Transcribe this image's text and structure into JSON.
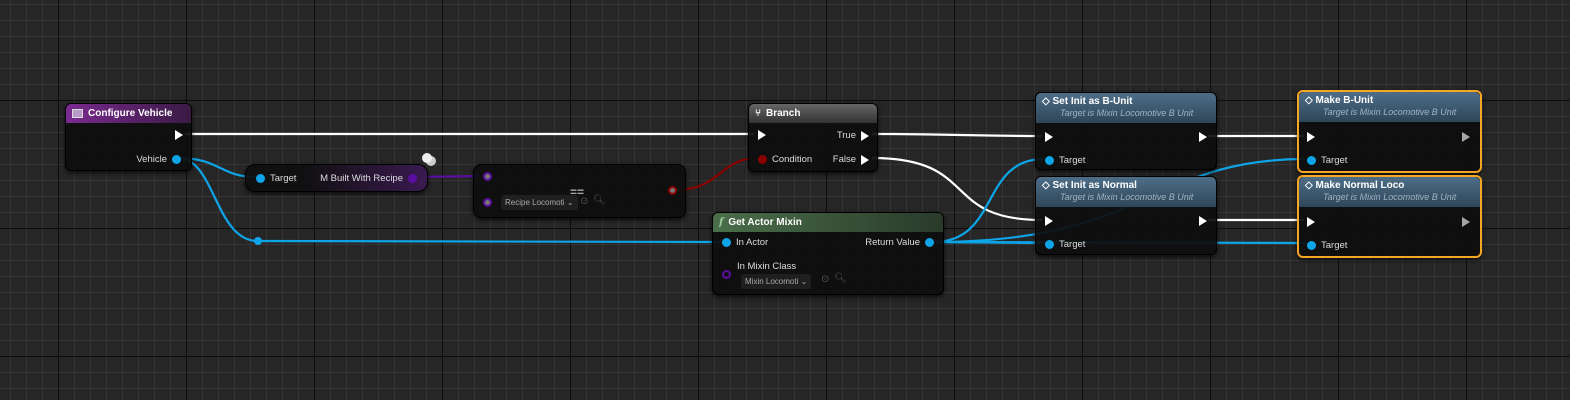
{
  "nodes": {
    "configure_vehicle": {
      "title": "Configure Vehicle",
      "pin_vehicle": "Vehicle"
    },
    "getter": {
      "target": "Target",
      "output": "M Built With Recipe"
    },
    "equal": {
      "operator": "==",
      "dropdown": "Recipe Locomoti"
    },
    "branch": {
      "title": "Branch",
      "condition": "Condition",
      "true": "True",
      "false": "False"
    },
    "get_actor_mixin": {
      "title": "Get Actor Mixin",
      "in_actor": "In Actor",
      "return_value": "Return Value",
      "in_mixin_class": "In Mixin Class",
      "dropdown": "Mixin Locomoti"
    },
    "set_b_unit": {
      "title": "Set Init as B-Unit",
      "subtitle": "Target is Mixin Locomotive B Unit",
      "target": "Target"
    },
    "set_normal": {
      "title": "Set Init as Normal",
      "subtitle": "Target is Mixin Locomotive B Unit",
      "target": "Target"
    },
    "make_b_unit": {
      "title": "Make B-Unit",
      "subtitle": "Target is Mixin Locomotive B Unit",
      "target": "Target"
    },
    "make_normal": {
      "title": "Make Normal Loco",
      "subtitle": "Target is Mixin Locomotive B Unit",
      "target": "Target"
    }
  },
  "colors": {
    "exec": "#ffffff",
    "object": "#0ea5e8",
    "enum": "#5a0fa0",
    "bool": "#8b0000",
    "selected": "#f5a623",
    "event_header": "#7a2a8f",
    "function_header": "#4a6e4a",
    "message_header": "#3f5f78"
  }
}
